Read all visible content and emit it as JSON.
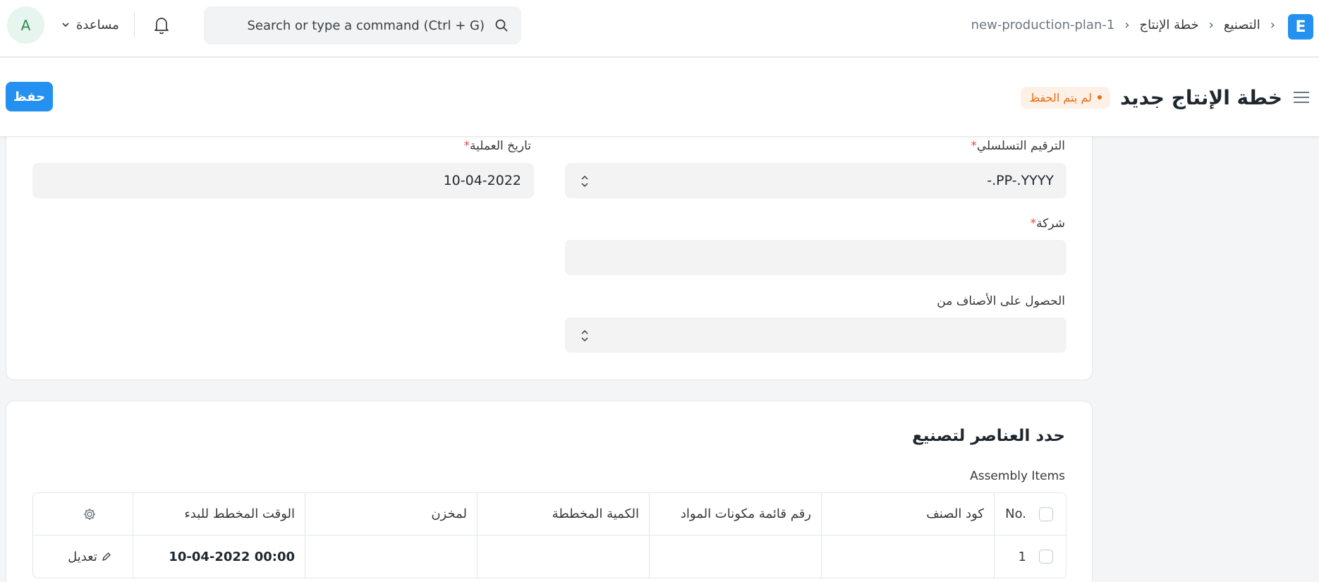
{
  "navbar": {
    "avatar_initial": "A",
    "help_label": "مساعدة",
    "search_placeholder": "Search or type a command (Ctrl + G)",
    "breadcrumbs": [
      "التصنيع",
      "خطة الإنتاج",
      "new-production-plan-1"
    ],
    "app_logo_letter": "E"
  },
  "header": {
    "title": "خطة الإنتاج جديد",
    "status": "لم يتم الحفظ",
    "save_label": "حفظ"
  },
  "form": {
    "naming_series": {
      "label": "الترقيم التسلسلي",
      "value": "-.PP-.YYYY"
    },
    "posting_date": {
      "label": "تاريخ العملية",
      "value": "10-04-2022"
    },
    "company": {
      "label": "شركة",
      "value": ""
    },
    "get_items_from": {
      "label": "الحصول على الأصناف من",
      "value": ""
    }
  },
  "assembly": {
    "section_title": "حدد العناصر لتصنيع",
    "grid_label": "Assembly Items",
    "columns": {
      "no": "No.",
      "item_code": "كود الصنف",
      "bom_no": "رقم قائمة مكونات المواد",
      "planned_qty": "الكمية المخططة",
      "warehouse": "لمخزن",
      "planned_start": "الوقت المخطط للبدء"
    },
    "rows": [
      {
        "no": "1",
        "item_code": "",
        "bom_no": "",
        "planned_qty": "",
        "warehouse": "",
        "planned_start": "10-04-2022 00:00",
        "edit_label": "تعديل"
      }
    ]
  },
  "colors": {
    "primary": "#2490ef",
    "status_orange": "#e86c13",
    "required_red": "#e24c4c"
  },
  "icons": [
    "user-avatar",
    "chevron-down-icon",
    "bell-icon",
    "search-icon",
    "app-logo",
    "hamburger-icon",
    "updown-icon",
    "gear-icon",
    "pencil-icon"
  ]
}
